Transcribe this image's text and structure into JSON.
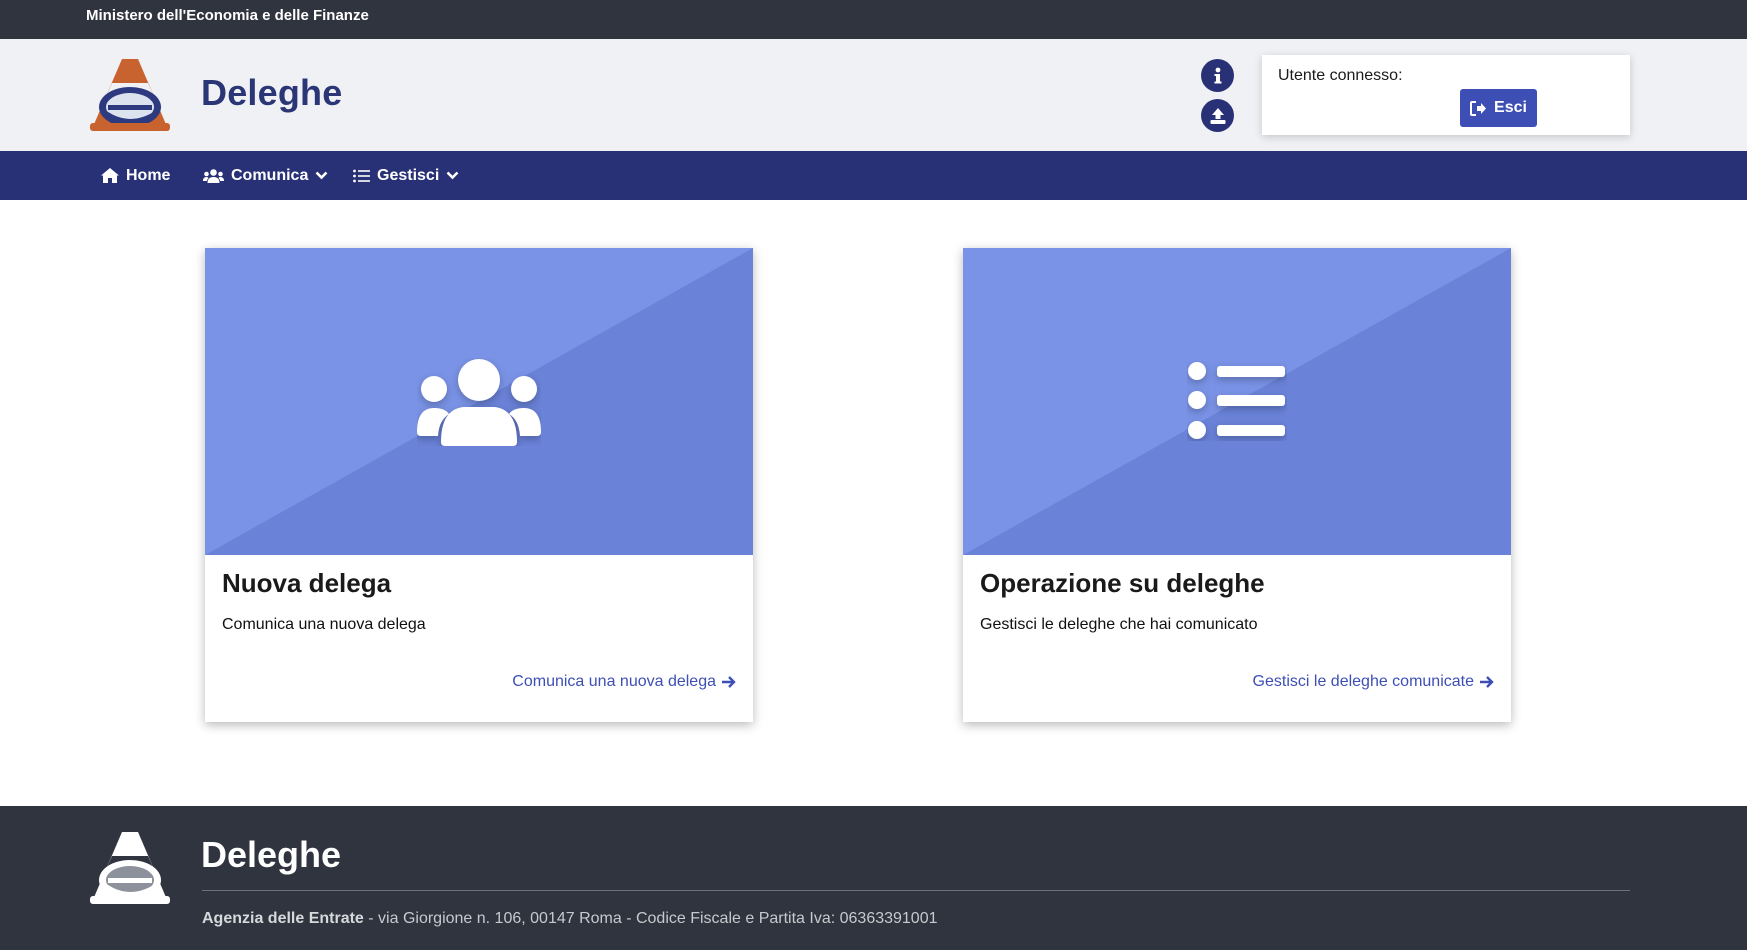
{
  "topbar": {
    "ministry": "Ministero dell'Economia e delle Finanze"
  },
  "header": {
    "app_title": "Deleghe",
    "info_button": "info-icon",
    "upload_button": "upload-icon",
    "user_label": "Utente connesso:",
    "logout_label": "Esci"
  },
  "nav": {
    "items": [
      {
        "label": "Home",
        "icon": "home-icon"
      },
      {
        "label": "Comunica",
        "icon": "users-icon"
      },
      {
        "label": "Gestisci",
        "icon": "list-icon"
      }
    ]
  },
  "cards": [
    {
      "title": "Nuova delega",
      "text": "Comunica una nuova delega",
      "link": "Comunica una nuova delega",
      "icon": "users-icon"
    },
    {
      "title": "Operazione su deleghe",
      "text": "Gestisci le deleghe che hai comunicato",
      "link": "Gestisci le deleghe comunicate",
      "icon": "list-icon"
    }
  ],
  "footer": {
    "title": "Deleghe",
    "org": "Agenzia delle Entrate",
    "address": " - via Giorgione n. 106, 00147 Roma - Codice Fiscale e Partita Iva: 06363391001"
  },
  "colors": {
    "topbar": "#30343f",
    "nav": "#293176",
    "accent": "#3d4fb5",
    "card_light": "#7a93e6",
    "card_dark": "#6a82d8"
  }
}
